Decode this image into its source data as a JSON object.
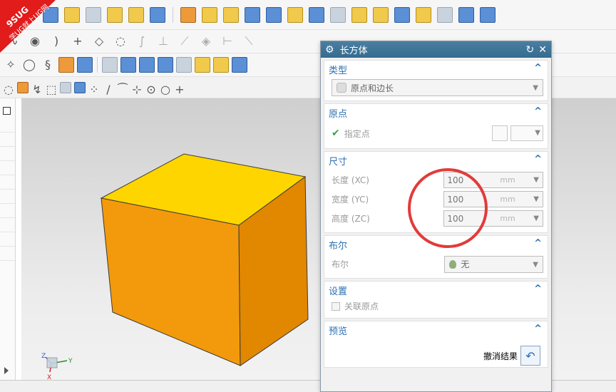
{
  "watermark": {
    "line1": "9SUG",
    "line2": "学UG就上UG网"
  },
  "dialog": {
    "title": "长方体",
    "sections": {
      "type": {
        "header": "类型",
        "value": "原点和边长"
      },
      "origin": {
        "header": "原点",
        "specify_point": "指定点"
      },
      "dimensions": {
        "header": "尺寸",
        "rows": [
          {
            "label": "长度 (XC)",
            "value": "100",
            "unit": "mm"
          },
          {
            "label": "宽度 (YC)",
            "value": "100",
            "unit": "mm"
          },
          {
            "label": "高度 (ZC)",
            "value": "100",
            "unit": "mm"
          }
        ]
      },
      "boolean": {
        "header": "布尔",
        "label": "布尔",
        "value": "无"
      },
      "settings": {
        "header": "设置",
        "associative_origin": "关联原点"
      },
      "preview": {
        "header": "预览",
        "undo_result": "撤消结果"
      }
    }
  },
  "triad": {
    "x": "X",
    "y": "Y",
    "z": "Z"
  },
  "colors": {
    "cube_top": "#ffd500",
    "cube_front": "#f29a0c",
    "cube_right": "#e28700",
    "annotation_circle": "#e23b3b",
    "title_bar": "#3b739a",
    "section_header": "#2c6fb0"
  }
}
